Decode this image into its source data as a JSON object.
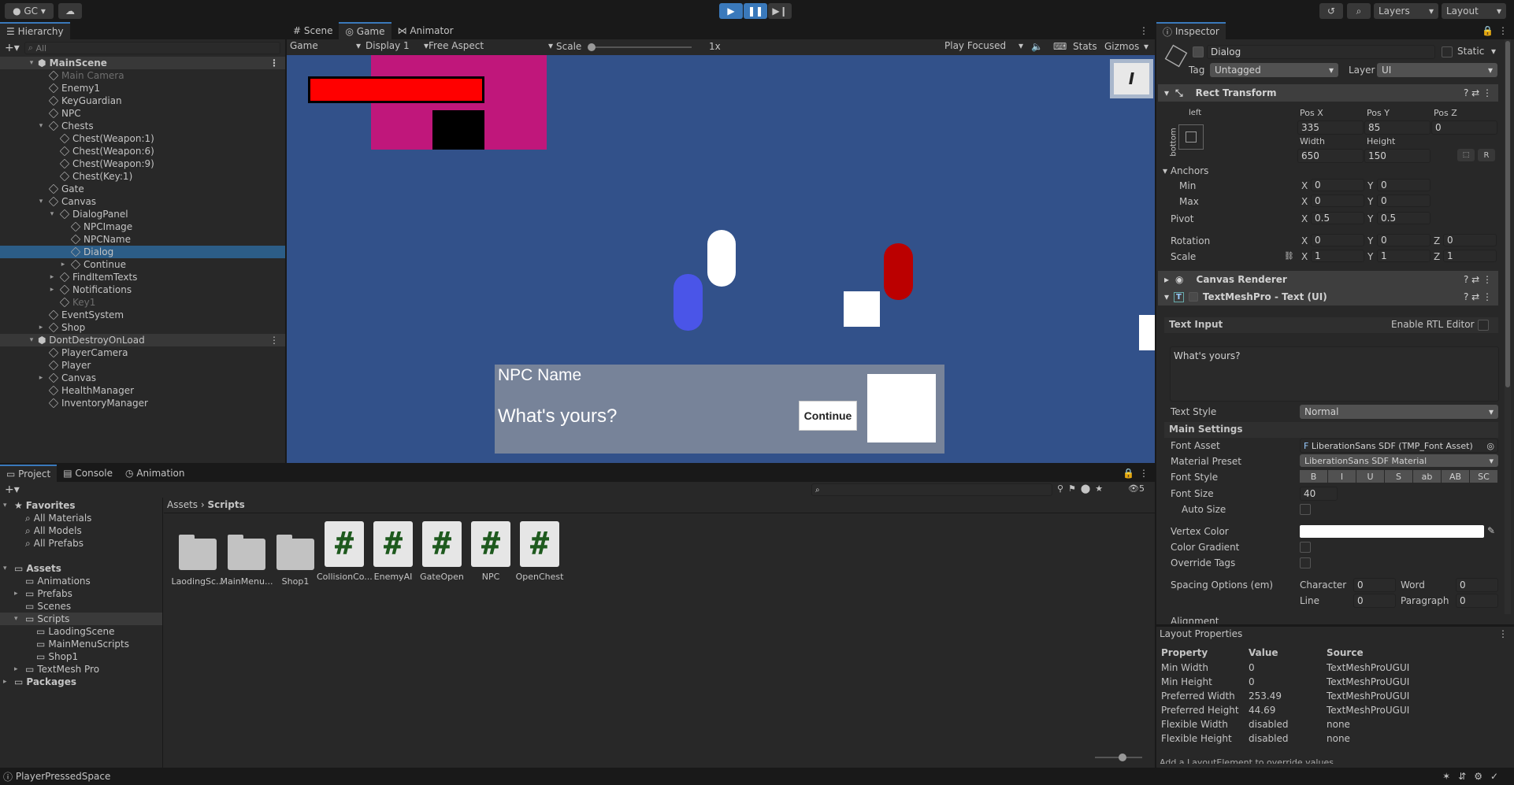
{
  "toolbar": {
    "account": "GC",
    "layers": "Layers",
    "layout": "Layout"
  },
  "hierarchy": {
    "title": "Hierarchy",
    "search_placeholder": "All",
    "scene1": "MainScene",
    "items": [
      "Main Camera",
      "Enemy1",
      "KeyGuardian",
      "NPC",
      "Chests",
      "Chest(Weapon:1)",
      "Chest(Weapon:6)",
      "Chest(Weapon:9)",
      "Chest(Key:1)",
      "Gate",
      "Canvas",
      "DialogPanel",
      "NPCImage",
      "NPCName",
      "Dialog",
      "Continue",
      "FindItemTexts",
      "Notifications",
      "Key1",
      "EventSystem",
      "Shop"
    ],
    "scene2": "DontDestroyOnLoad",
    "items2": [
      "PlayerCamera",
      "Player",
      "Canvas",
      "HealthManager",
      "InventoryManager"
    ]
  },
  "view": {
    "tabs": [
      "Scene",
      "Game",
      "Animator"
    ],
    "game_dropdown": "Game",
    "display": "Display 1",
    "aspect": "Free Aspect",
    "scale_label": "Scale",
    "scale_value": "1x",
    "play_focused": "Play Focused",
    "stats": "Stats",
    "gizmos": "Gizmos"
  },
  "dialog": {
    "npc_name": "NPC Name",
    "text": "What's yours?",
    "continue": "Continue"
  },
  "inspector": {
    "title": "Inspector",
    "object_name": "Dialog",
    "static": "Static",
    "tag_label": "Tag",
    "tag": "Untagged",
    "layer_label": "Layer",
    "layer": "UI",
    "rect_transform": "Rect Transform",
    "anchor_h": "left",
    "anchor_v": "bottom",
    "pos_x_label": "Pos X",
    "pos_y_label": "Pos Y",
    "pos_z_label": "Pos Z",
    "pos_x": "335",
    "pos_y": "85",
    "pos_z": "0",
    "width_label": "Width",
    "height_label": "Height",
    "width": "650",
    "height": "150",
    "anchors": "Anchors",
    "min": "Min",
    "max": "Max",
    "pivot": "Pivot",
    "rotation": "Rotation",
    "scale": "Scale",
    "x": "X",
    "y": "Y",
    "z": "Z",
    "R": "R",
    "min_x": "0",
    "min_y": "0",
    "max_x": "0",
    "max_y": "0",
    "pivot_x": "0.5",
    "pivot_y": "0.5",
    "rot_x": "0",
    "rot_y": "0",
    "rot_z": "0",
    "scale_x": "1",
    "scale_y": "1",
    "scale_z": "1",
    "canvas_renderer": "Canvas Renderer",
    "tmp": "TextMeshPro - Text (UI)",
    "text_input": "Text Input",
    "rtl": "Enable RTL Editor",
    "text_value": "What's yours?",
    "text_style_label": "Text Style",
    "text_style": "Normal",
    "main_settings": "Main Settings",
    "font_asset_label": "Font Asset",
    "font_asset": "LiberationSans SDF (TMP_Font Asset)",
    "material_label": "Material Preset",
    "material": "LiberationSans SDF Material",
    "font_style_label": "Font Style",
    "font_styles": [
      "B",
      "I",
      "U",
      "S",
      "ab",
      "AB",
      "SC"
    ],
    "font_size_label": "Font Size",
    "font_size": "40",
    "auto_size": "Auto Size",
    "vertex_color": "Vertex Color",
    "color_gradient": "Color Gradient",
    "override_tags": "Override Tags",
    "spacing": "Spacing Options (em)",
    "character": "Character",
    "word": "Word",
    "line": "Line",
    "paragraph": "Paragraph",
    "char_v": "0",
    "word_v": "0",
    "line_v": "0",
    "para_v": "0",
    "alignment": "Alignment"
  },
  "layout_props": {
    "title": "Layout Properties",
    "headers": [
      "Property",
      "Value",
      "Source"
    ],
    "rows": [
      [
        "Min Width",
        "0",
        "TextMeshProUGUI"
      ],
      [
        "Min Height",
        "0",
        "TextMeshProUGUI"
      ],
      [
        "Preferred Width",
        "253.49",
        "TextMeshProUGUI"
      ],
      [
        "Preferred Height",
        "44.69",
        "TextMeshProUGUI"
      ],
      [
        "Flexible Width",
        "disabled",
        "none"
      ],
      [
        "Flexible Height",
        "disabled",
        "none"
      ]
    ],
    "footer": "Add a LayoutElement to override values"
  },
  "project": {
    "tabs": [
      "Project",
      "Console",
      "Animation"
    ],
    "favorites": "Favorites",
    "fav_items": [
      "All Materials",
      "All Models",
      "All Prefabs"
    ],
    "assets": "Assets",
    "asset_folders": [
      "Animations",
      "Prefabs",
      "Scenes",
      "Scripts",
      "LaodingScene",
      "MainMenuScripts",
      "Shop1",
      "TextMesh Pro"
    ],
    "packages": "Packages",
    "breadcrumb": [
      "Assets",
      "Scripts"
    ],
    "hidden_count": "5",
    "grid": [
      "LaodingSc...",
      "MainMenu...",
      "Shop1",
      "CollisionCo...",
      "EnemyAI",
      "GateOpen",
      "NPC",
      "OpenChest"
    ]
  },
  "status": {
    "message": "PlayerPressedSpace"
  },
  "colors": {
    "accent": "#3a79bb",
    "game_bg": "#32518a",
    "selection": "#2c5d87"
  }
}
